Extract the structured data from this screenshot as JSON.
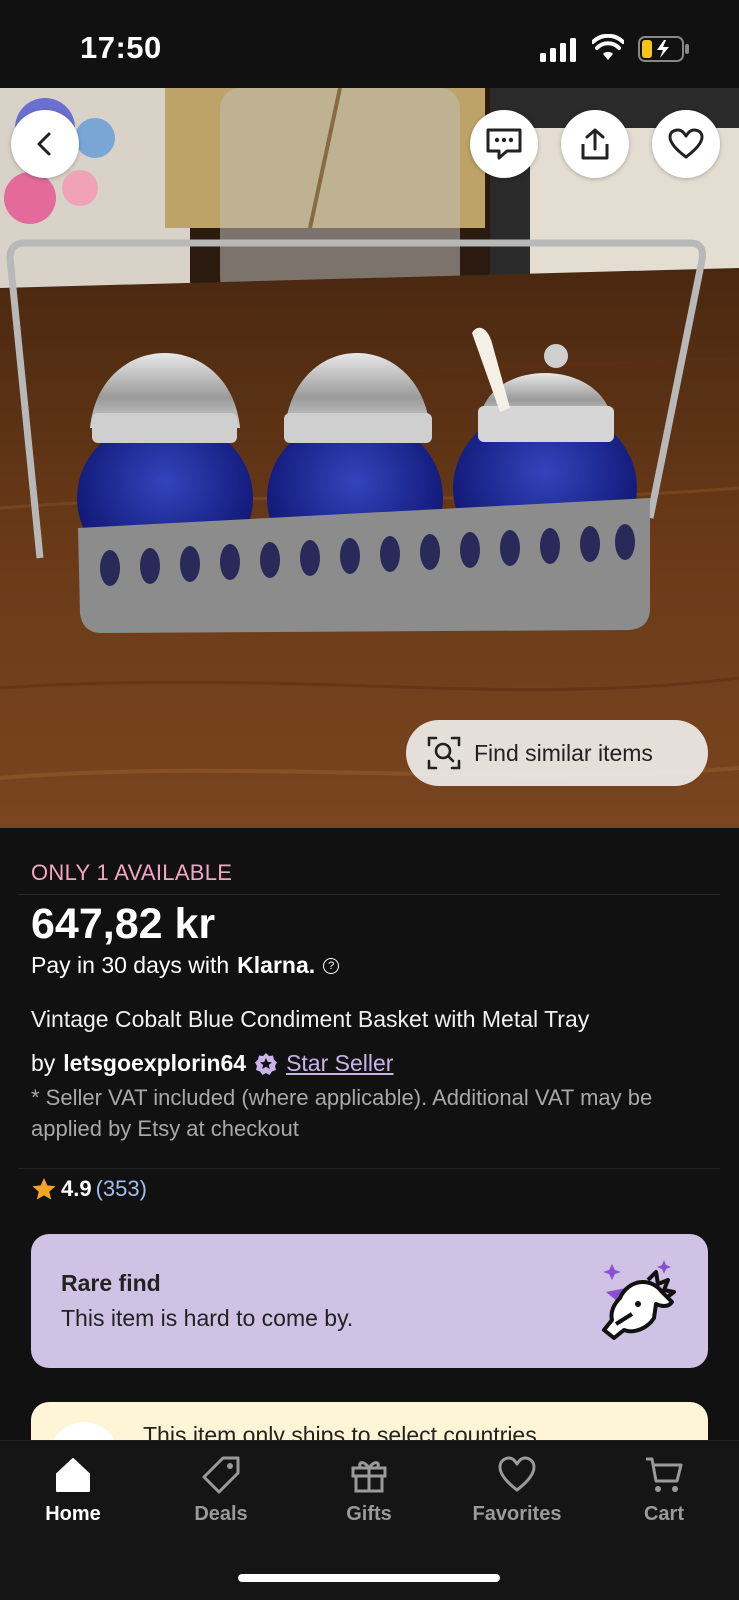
{
  "status_bar": {
    "time": "17:50"
  },
  "product": {
    "availability": "ONLY 1 AVAILABLE",
    "price": "647,82 kr",
    "payment_text": "Pay in 30 days with",
    "payment_brand": "Klarna.",
    "help_glyph": "?",
    "title": "Vintage Cobalt Blue Condiment Basket with Metal Tray",
    "by_label": "by",
    "seller": "letsgoexplorin64",
    "seller_badge": "Star Seller",
    "vat_note": "* Seller VAT included (where applicable). Additional VAT may be applied by Etsy at checkout",
    "rating": "4.9",
    "review_count": "(353)"
  },
  "hero": {
    "find_similar_label": "Find similar items"
  },
  "rare_card": {
    "title": "Rare find",
    "subtitle": "This item is hard to come by."
  },
  "shipping_notice": "This item only ships to select countries",
  "tabs": [
    {
      "label": "Home",
      "icon": "home-icon",
      "active": true
    },
    {
      "label": "Deals",
      "icon": "tag-icon",
      "active": false
    },
    {
      "label": "Gifts",
      "icon": "gift-icon",
      "active": false
    },
    {
      "label": "Favorites",
      "icon": "heart-icon",
      "active": false
    },
    {
      "label": "Cart",
      "icon": "cart-icon",
      "active": false
    }
  ],
  "colors": {
    "availability": "#f2a6c2",
    "star_seller": "#c9b4ea",
    "rare_card_bg": "#cfc2e4",
    "ship_card_bg": "#fdf5d6",
    "review_link": "#9ebef0"
  }
}
